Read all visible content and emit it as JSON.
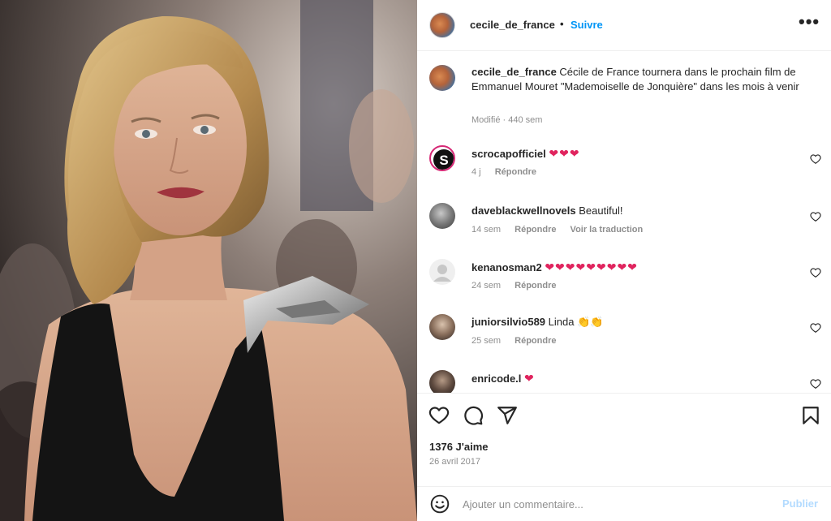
{
  "post": {
    "username": "cecile_de_france",
    "separator": "•",
    "follow_label": "Suivre",
    "more_label": "•••",
    "caption": {
      "username": "cecile_de_france",
      "text": "Cécile de France tournera dans le prochain film de Emmanuel Mouret \"Mademoiselle de Jonquière\" dans les mois à venir",
      "meta": "Modifié · 440 sem"
    },
    "comments": [
      {
        "user": "scrocapofficiel",
        "text": "",
        "emoji": "❤❤❤",
        "time": "4 j",
        "reply": "Répondre",
        "translate": ""
      },
      {
        "user": "daveblackwellnovels",
        "text": "Beautiful!",
        "emoji": "",
        "time": "14 sem",
        "reply": "Répondre",
        "translate": "Voir la traduction"
      },
      {
        "user": "kenanosman2",
        "text": "",
        "emoji": "❤❤❤❤❤❤❤❤❤",
        "time": "24 sem",
        "reply": "Répondre",
        "translate": ""
      },
      {
        "user": "juniorsilvio589",
        "text": "Linda",
        "emoji": "👏👏",
        "time": "25 sem",
        "reply": "Répondre",
        "translate": ""
      },
      {
        "user": "enricode.l",
        "text": "",
        "emoji": "❤",
        "time": "",
        "reply": "",
        "translate": ""
      }
    ],
    "likes": "1376 J'aime",
    "date": "26 avril 2017",
    "add_comment": {
      "placeholder": "Ajouter un commentaire...",
      "publish_label": "Publier"
    }
  },
  "icons": [
    "like-icon",
    "comment-icon",
    "share-icon",
    "save-icon",
    "emoji-icon",
    "more-icon"
  ],
  "colors": {
    "link_blue": "#0095f6",
    "publish_disabled": "#b3dbff",
    "heart_red": "#e0245e",
    "muted": "#8e8e8e"
  }
}
